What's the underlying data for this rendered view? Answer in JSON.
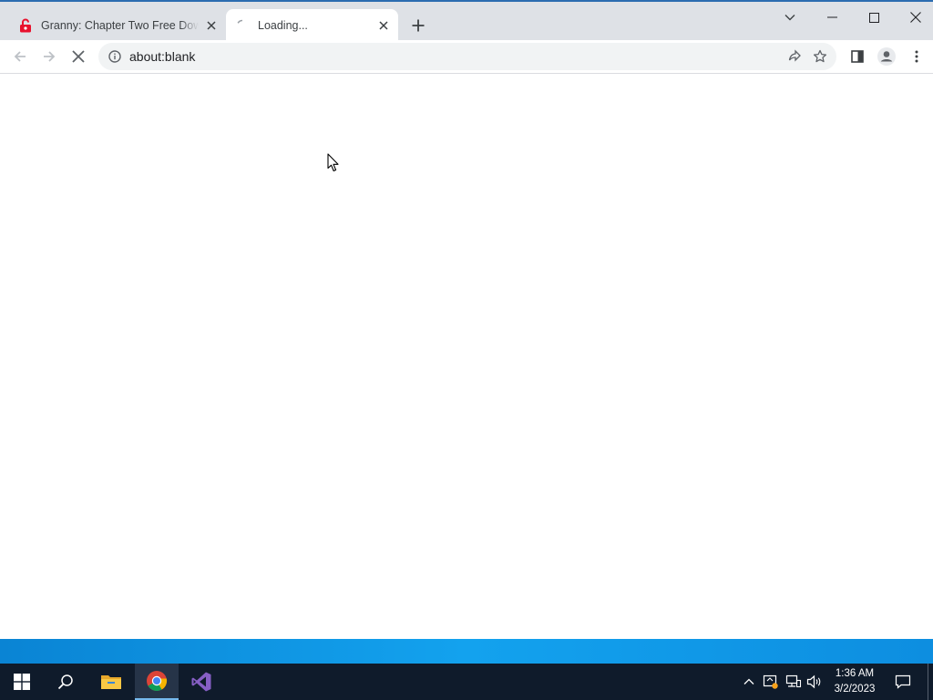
{
  "browser": {
    "tabs": [
      {
        "title": "Granny: Chapter Two Free Download",
        "favicon": "red-lock-favicon",
        "state": "inactive"
      },
      {
        "title": "Loading...",
        "favicon": "loading-spinner",
        "state": "active"
      }
    ],
    "address": {
      "url": "about:blank"
    },
    "nav_state": "loading"
  },
  "taskbar": {
    "apps": [
      "start-icon",
      "search-icon",
      "file-explorer-icon",
      "chrome-icon",
      "visual-studio-icon"
    ],
    "active_app": "chrome-icon",
    "tray": [
      "chevron-up-icon",
      "security-icon",
      "network-icon",
      "volume-icon"
    ],
    "clock": {
      "time": "1:36 AM",
      "date": "3/2/2023"
    }
  },
  "colors": {
    "tab_strip": "#dee1e6",
    "omnibox": "#f1f3f4",
    "taskbar": "#0f1b2b",
    "desktop_accent": "#13a2ee",
    "favicon_red": "#e8112d"
  }
}
